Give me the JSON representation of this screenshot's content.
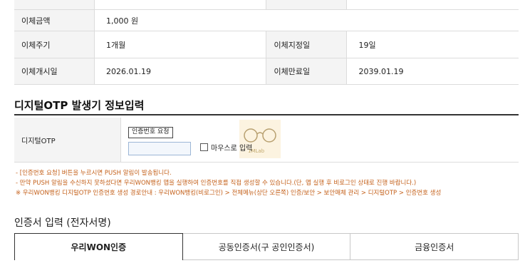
{
  "transfer": {
    "amount_label": "이체금액",
    "amount_value": "1,000 원",
    "cycle_label": "이체주기",
    "cycle_value": "1개월",
    "day_label": "이체지정일",
    "day_value": "19일",
    "start_label": "이체개시일",
    "start_value": "2026.01.19",
    "end_label": "이체만료일",
    "end_value": "2039.01.19"
  },
  "otp_section": {
    "title": "디지털OTP 발생기 정보입력",
    "label": "디지털OTP",
    "request_button": "인증번호 요청",
    "input_placeholder": "",
    "mouse_input_label": "마우스로 입력",
    "watermark_text": "1MLab"
  },
  "notes": [
    "- [인증번호 요청] 버튼을 누르시면 PUSH 알림이 발송됩니다.",
    "- 만약 PUSH 알림을 수신하지 못하셨다면 우리WON뱅킹 앱을 실행하여 인증번호를 직접 생성할 수 있습니다.(단, 앱 실행 후 비로그인 상태로 진행 바랍니다.)",
    "  ※ 우리WON뱅킹 디지털OTP 인증번호 생성 경로안내 : 우리WON뱅킹(비로그인) > 전체메뉴(상단 오른쪽) 인증/보안 > 보안매체 관리 > 디지털OTP > 인증번호 생성"
  ],
  "cert": {
    "title": "인증서 입력 (전자서명)",
    "tabs": [
      {
        "label": "우리WON인증",
        "active": true
      },
      {
        "label": "공동인증서(구 공인인증서)",
        "active": false
      },
      {
        "label": "금융인증서",
        "active": false
      }
    ]
  },
  "colors": {
    "note_text": "#c4601a",
    "label_bg": "#f4f4f4",
    "input_border": "#9cb6d6"
  }
}
